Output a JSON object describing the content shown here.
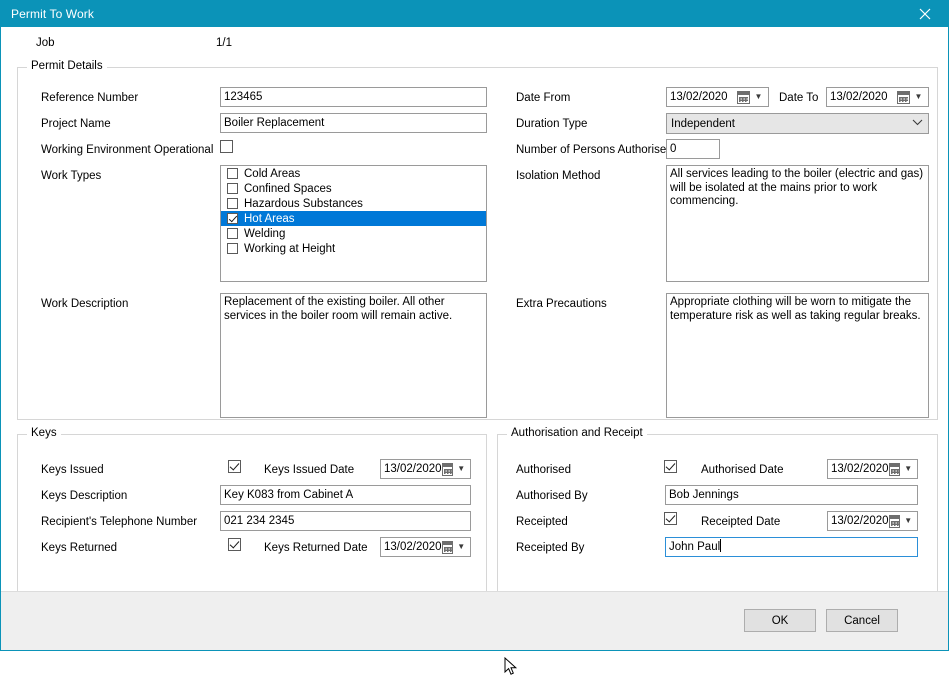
{
  "window": {
    "title": "Permit To Work",
    "close_icon": "close-icon",
    "accent_color": "#0b93b8",
    "selection_color": "#0078d7"
  },
  "job": {
    "label": "Job",
    "value": "1/1"
  },
  "permit_details": {
    "legend": "Permit Details",
    "reference_number": {
      "label": "Reference Number",
      "value": "123465"
    },
    "project_name": {
      "label": "Project Name",
      "value": "Boiler Replacement"
    },
    "working_environment_operational": {
      "label": "Working Environment Operational",
      "checked": false
    },
    "work_types": {
      "label": "Work Types",
      "items": [
        {
          "label": "Cold Areas",
          "checked": false,
          "selected": false
        },
        {
          "label": "Confined Spaces",
          "checked": false,
          "selected": false
        },
        {
          "label": "Hazardous Substances",
          "checked": false,
          "selected": false
        },
        {
          "label": "Hot Areas",
          "checked": true,
          "selected": true
        },
        {
          "label": "Welding",
          "checked": false,
          "selected": false
        },
        {
          "label": "Working at Height",
          "checked": false,
          "selected": false
        }
      ]
    },
    "work_description": {
      "label": "Work Description",
      "value": "Replacement of the existing boiler. All other services in the boiler room will remain active."
    },
    "date_from": {
      "label": "Date From",
      "value": "13/02/2020",
      "icon": "calendar-icon"
    },
    "date_to": {
      "label": "Date To",
      "value": "13/02/2020",
      "icon": "calendar-icon"
    },
    "duration_type": {
      "label": "Duration Type",
      "value": "Independent",
      "icon": "chevron-down-icon"
    },
    "number_of_persons_authorised": {
      "label": "Number of Persons Authorised",
      "value": "0"
    },
    "isolation_method": {
      "label": "Isolation Method",
      "value": "All services leading to the boiler (electric and gas) will be isolated at the mains prior to work commencing."
    },
    "extra_precautions": {
      "label": "Extra Precautions",
      "value": "Appropriate clothing will be worn to mitigate the temperature risk as well as taking regular breaks."
    }
  },
  "keys": {
    "legend": "Keys",
    "keys_issued": {
      "label": "Keys Issued",
      "checked": true
    },
    "keys_issued_date": {
      "label": "Keys Issued Date",
      "value": "13/02/2020",
      "icon": "calendar-icon"
    },
    "keys_description": {
      "label": "Keys Description",
      "value": "Key K083 from Cabinet A"
    },
    "recipient_telephone": {
      "label": "Recipient's Telephone Number",
      "value": "021 234 2345"
    },
    "keys_returned": {
      "label": "Keys Returned",
      "checked": true
    },
    "keys_returned_date": {
      "label": "Keys Returned Date",
      "value": "13/02/2020",
      "icon": "calendar-icon"
    }
  },
  "authorisation": {
    "legend": "Authorisation and Receipt",
    "authorised": {
      "label": "Authorised",
      "checked": true
    },
    "authorised_date": {
      "label": "Authorised Date",
      "value": "13/02/2020",
      "icon": "calendar-icon"
    },
    "authorised_by": {
      "label": "Authorised By",
      "value": "Bob Jennings"
    },
    "receipted": {
      "label": "Receipted",
      "checked": true
    },
    "receipted_date": {
      "label": "Receipted Date",
      "value": "13/02/2020",
      "icon": "calendar-icon"
    },
    "receipted_by": {
      "label": "Receipted By",
      "value": "John Paul",
      "focused": true
    }
  },
  "footer": {
    "ok_label": "OK",
    "cancel_label": "Cancel"
  }
}
